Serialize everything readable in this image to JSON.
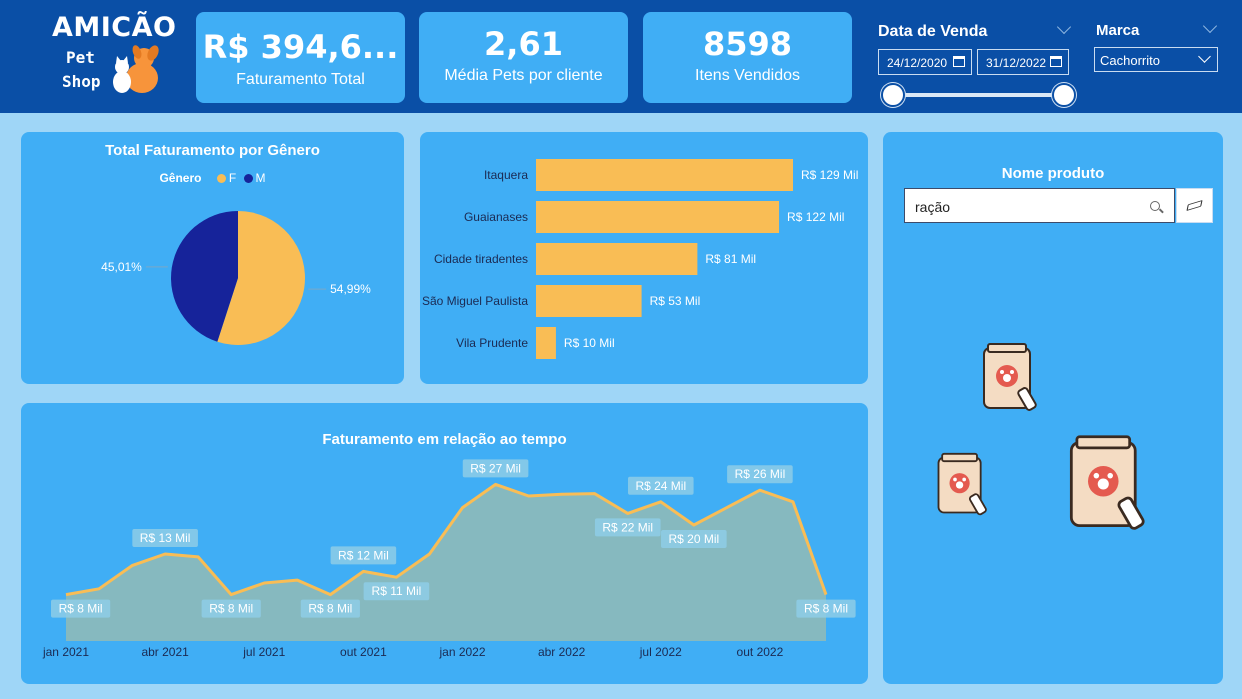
{
  "logo": {
    "title": "AMICÃO",
    "line2": "Pet",
    "line3": "Shop"
  },
  "kpis": [
    {
      "value": "R$ 394,6...",
      "label": "Faturamento Total"
    },
    {
      "value": "2,61",
      "label": "Média Pets por cliente"
    },
    {
      "value": "8598",
      "label": "Itens Vendidos"
    }
  ],
  "date_slicer": {
    "title": "Data de Venda",
    "start": "24/12/2020",
    "end": "31/12/2022"
  },
  "brand_slicer": {
    "title": "Marca",
    "selected": "Cachorrito"
  },
  "gender_chart": {
    "title": "Total Faturamento por Gênero",
    "legend_title": "Gênero",
    "label_f": "54,99%",
    "label_m": "45,01%"
  },
  "product_search": {
    "title": "Nome produto",
    "value": "ração"
  },
  "time_chart_title": "Faturamento em relação ao tempo",
  "colors": {
    "accent_yellow": "#f9bd55",
    "dark_navy": "#16239a",
    "area_fill": "#86b9bf",
    "panel": "#40aef5",
    "header": "#0a4fa6"
  },
  "chart_data": [
    {
      "type": "pie",
      "title": "Total Faturamento por Gênero",
      "legend_title": "Gênero",
      "legend_position": "top",
      "series": [
        {
          "name": "F",
          "value": 54.99,
          "label": "54,99%",
          "color": "#f9bd55"
        },
        {
          "name": "M",
          "value": 45.01,
          "label": "45,01%",
          "color": "#16239a"
        }
      ]
    },
    {
      "type": "bar",
      "orientation": "horizontal",
      "categories": [
        "Itaquera",
        "Guaianases",
        "Cidade tiradentes",
        "São Miguel Paulista",
        "Vila Prudente"
      ],
      "values": [
        129,
        122,
        81,
        53,
        10
      ],
      "value_labels": [
        "R$ 129 Mil",
        "R$ 122 Mil",
        "R$ 81 Mil",
        "R$ 53 Mil",
        "R$ 10 Mil"
      ],
      "xlim": [
        0,
        140
      ],
      "color": "#f9bd55"
    },
    {
      "type": "area",
      "title": "Faturamento em relação ao tempo",
      "x": [
        "jan 2021",
        "fev 2021",
        "mar 2021",
        "abr 2021",
        "mai 2021",
        "jun 2021",
        "jul 2021",
        "ago 2021",
        "set 2021",
        "out 2021",
        "nov 2021",
        "dez 2021",
        "jan 2022",
        "fev 2022",
        "mar 2022",
        "abr 2022",
        "mai 2022",
        "jun 2022",
        "jul 2022",
        "ago 2022",
        "set 2022",
        "out 2022",
        "nov 2022",
        "dez 2022"
      ],
      "x_ticks": [
        "jan 2021",
        "abr 2021",
        "jul 2021",
        "out 2021",
        "jan 2022",
        "abr 2022",
        "jul 2022",
        "out 2022"
      ],
      "values": [
        8,
        9,
        13,
        15,
        14.5,
        8,
        10,
        10.5,
        8,
        12,
        11,
        15,
        23,
        27,
        25,
        25.3,
        25.4,
        22,
        24,
        20,
        23,
        26,
        24,
        8
      ],
      "data_labels": [
        {
          "index": 0,
          "label": "R$ 8 Mil",
          "pos": "below"
        },
        {
          "index": 3,
          "label": "R$ 13 Mil",
          "pos": "above"
        },
        {
          "index": 5,
          "label": "R$ 8 Mil",
          "pos": "below"
        },
        {
          "index": 8,
          "label": "R$ 8 Mil",
          "pos": "below"
        },
        {
          "index": 9,
          "label": "R$ 12 Mil",
          "pos": "above"
        },
        {
          "index": 10,
          "label": "R$ 11 Mil",
          "pos": "below"
        },
        {
          "index": 13,
          "label": "R$ 27 Mil",
          "pos": "above"
        },
        {
          "index": 17,
          "label": "R$ 22 Mil",
          "pos": "below"
        },
        {
          "index": 18,
          "label": "R$ 24 Mil",
          "pos": "above"
        },
        {
          "index": 19,
          "label": "R$ 20 Mil",
          "pos": "below"
        },
        {
          "index": 21,
          "label": "R$ 26 Mil",
          "pos": "above"
        },
        {
          "index": 23,
          "label": "R$ 8 Mil",
          "pos": "below"
        }
      ],
      "ylim": [
        0,
        30
      ],
      "line_color": "#f9bd55",
      "fill_color": "#86b9bf"
    }
  ]
}
